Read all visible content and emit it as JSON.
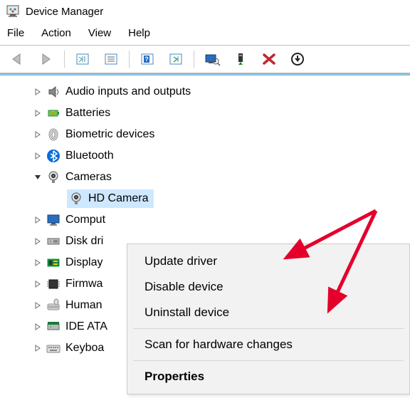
{
  "window": {
    "title": "Device Manager"
  },
  "menu": {
    "file": "File",
    "action": "Action",
    "view": "View",
    "help": "Help"
  },
  "toolbar_icons": {
    "back": "back-arrow",
    "forward": "forward-arrow",
    "show_hidden": "show-hidden",
    "properties": "properties",
    "help": "help",
    "scan": "scan-hardware",
    "display": "display-toggle",
    "update": "update-driver",
    "remove": "remove-device",
    "uninstall": "uninstall-device"
  },
  "tree": {
    "items": [
      {
        "label": "Audio inputs and outputs",
        "expanded": false,
        "icon": "speaker"
      },
      {
        "label": "Batteries",
        "expanded": false,
        "icon": "battery"
      },
      {
        "label": "Biometric devices",
        "expanded": false,
        "icon": "fingerprint"
      },
      {
        "label": "Bluetooth",
        "expanded": false,
        "icon": "bluetooth"
      },
      {
        "label": "Cameras",
        "expanded": true,
        "icon": "camera",
        "children": [
          {
            "label": "HD Camera",
            "icon": "camera",
            "selected": true
          }
        ]
      },
      {
        "label": "Comput",
        "expanded": false,
        "icon": "monitor"
      },
      {
        "label": "Disk dri",
        "expanded": false,
        "icon": "disk"
      },
      {
        "label": "Display",
        "expanded": false,
        "icon": "display-adapter"
      },
      {
        "label": "Firmwa",
        "expanded": false,
        "icon": "firmware"
      },
      {
        "label": "Human",
        "expanded": false,
        "icon": "hid"
      },
      {
        "label": "IDE ATA",
        "expanded": false,
        "icon": "ide"
      },
      {
        "label": "Keyboa",
        "expanded": false,
        "icon": "keyboard"
      }
    ]
  },
  "context_menu": {
    "update": "Update driver",
    "disable": "Disable device",
    "uninstall": "Uninstall device",
    "scan": "Scan for hardware changes",
    "properties": "Properties"
  }
}
